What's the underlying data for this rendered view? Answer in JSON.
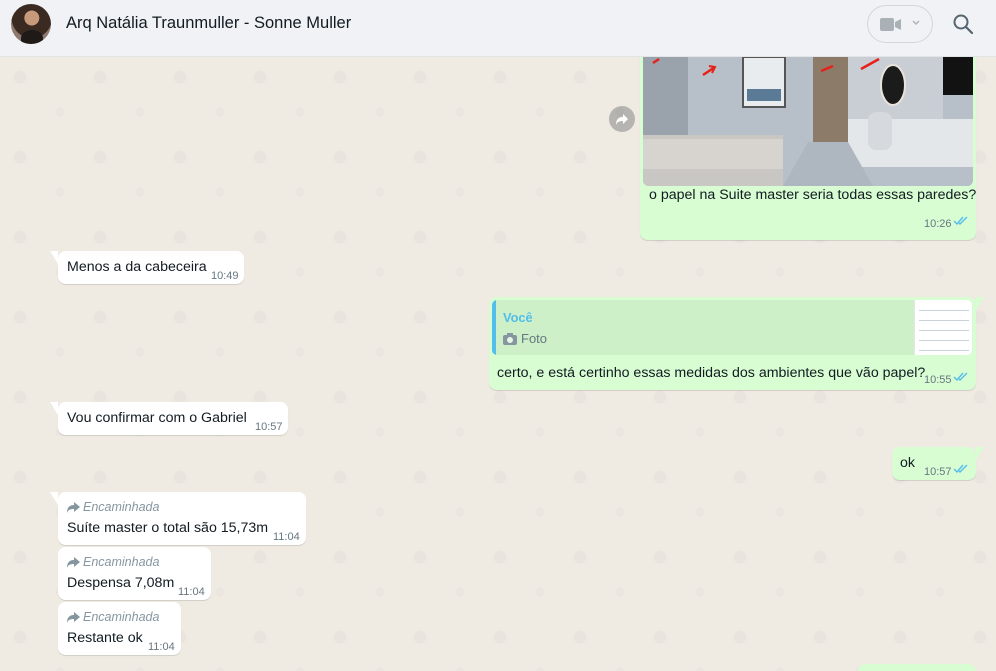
{
  "header": {
    "contact_name": "Arq Natália Traunmuller - Sonne Muller",
    "video_icon": "video-camera-icon",
    "search_icon": "search-icon"
  },
  "colors": {
    "incoming": "#ffffff",
    "outgoing": "#d9fdd3",
    "read_ticks": "#53bdeb",
    "background": "#efeae2"
  },
  "messages": [
    {
      "dir": "out",
      "type": "image",
      "caption": "o papel na Suite master seria todas essas paredes?",
      "time": "10:26",
      "status": "read"
    },
    {
      "dir": "in",
      "text": "Menos a da cabeceira",
      "time": "10:49"
    },
    {
      "dir": "out",
      "type": "reply",
      "quote_author": "Você",
      "quote_text": "Foto",
      "text": "certo, e está certinho essas medidas dos ambientes que vão papel?",
      "time": "10:55",
      "status": "read"
    },
    {
      "dir": "in",
      "text": "Vou confirmar com o Gabriel",
      "time": "10:57"
    },
    {
      "dir": "out",
      "text": "ok",
      "time": "10:57",
      "status": "read"
    },
    {
      "dir": "in",
      "forwarded": "Encaminhada",
      "text": "Suíte master o total são 15,73m",
      "time": "11:04"
    },
    {
      "dir": "in",
      "forwarded": "Encaminhada",
      "text": "Despensa 7,08m",
      "time": "11:04"
    },
    {
      "dir": "in",
      "forwarded": "Encaminhada",
      "text": "Restante ok",
      "time": "11:04"
    }
  ]
}
